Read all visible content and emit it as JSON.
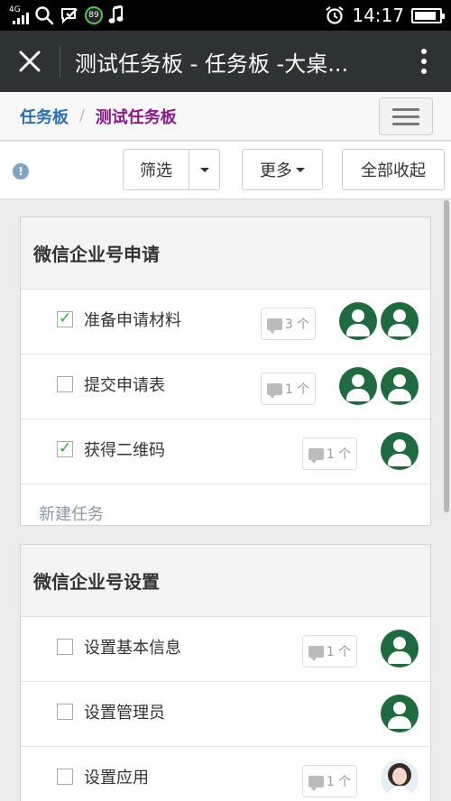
{
  "status_bar": {
    "network_label": "4G",
    "ring_badge": "89",
    "time": "14:17",
    "battery_percent": 90
  },
  "appbar": {
    "title": "测试任务板 - 任务板 -大桌..."
  },
  "breadcrumb": {
    "parent": "任务板",
    "separator": "/",
    "current": "测试任务板"
  },
  "toolbar": {
    "filter_label": "筛选",
    "more_label": "更多",
    "collapse_all_label": "全部收起",
    "info_icon": "!"
  },
  "lists": [
    {
      "title": "微信企业号申请",
      "tasks": [
        {
          "label": "准备申请材料",
          "checked": true,
          "comment_count": "3 个",
          "avatars": [
            "default",
            "default"
          ]
        },
        {
          "label": "提交申请表",
          "checked": false,
          "comment_count": "1 个",
          "avatars": [
            "default",
            "default"
          ]
        },
        {
          "label": "获得二维码",
          "checked": true,
          "comment_count": "1 个",
          "avatars": [
            "default"
          ]
        }
      ],
      "new_task_label": "新建任务"
    },
    {
      "title": "微信企业号设置",
      "tasks": [
        {
          "label": "设置基本信息",
          "checked": false,
          "comment_count": "1 个",
          "avatars": [
            "default"
          ]
        },
        {
          "label": "设置管理员",
          "checked": false,
          "comment_count": "",
          "avatars": [
            "default"
          ]
        },
        {
          "label": "设置应用",
          "checked": false,
          "comment_count": "1 个",
          "avatars": [
            "photo"
          ]
        }
      ]
    }
  ],
  "colors": {
    "appbar_bg": "#2d3234",
    "breadcrumb_parent": "#2a6fb5",
    "breadcrumb_current": "#8a1a8a",
    "avatar_green": "#1d6b3f",
    "check_green": "#3aab3a"
  }
}
